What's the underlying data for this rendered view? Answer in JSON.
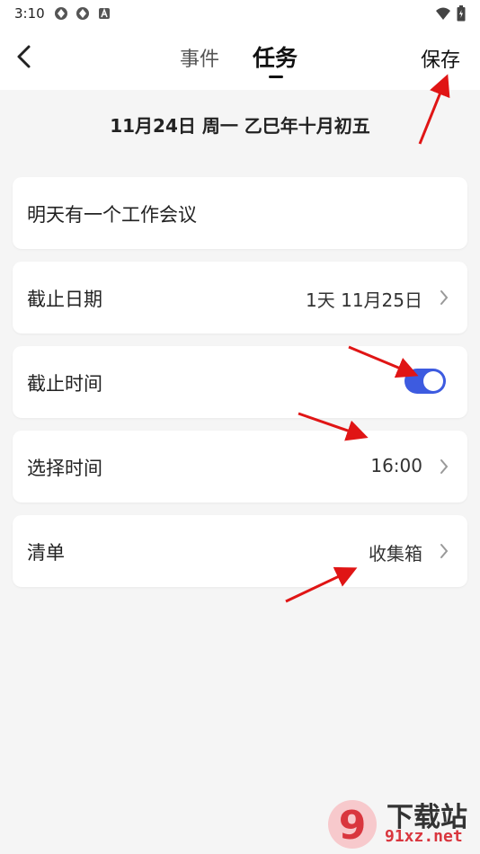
{
  "status_bar": {
    "time": "3:10",
    "icons": [
      "app-icon",
      "app-icon",
      "a-icon"
    ],
    "right_icons": [
      "wifi-icon",
      "battery-icon"
    ]
  },
  "header": {
    "tabs": [
      {
        "label": "事件",
        "active": false
      },
      {
        "label": "任务",
        "active": true
      }
    ],
    "save_label": "保存"
  },
  "date_line": "11月24日 周一 乙巳年十月初五",
  "task_title": "明天有一个工作会议",
  "rows": {
    "deadline_date": {
      "label": "截止日期",
      "value": "1天 11月25日"
    },
    "deadline_time": {
      "label": "截止时间",
      "enabled": true
    },
    "select_time": {
      "label": "选择时间",
      "value": "16:00"
    },
    "list": {
      "label": "清单",
      "value": "收集箱"
    }
  },
  "colors": {
    "accent": "#3d5be0",
    "background": "#f5f5f5",
    "annotation_arrow": "#e01515"
  },
  "watermark": {
    "text": "下载站",
    "url": "91xz.net",
    "logo_text": "9"
  }
}
